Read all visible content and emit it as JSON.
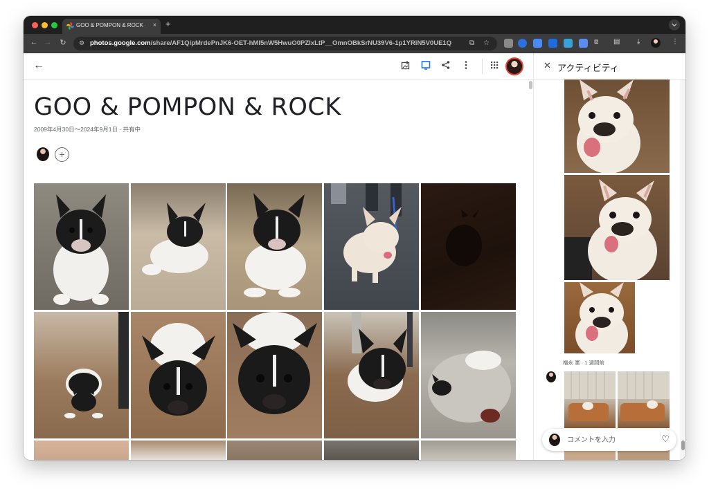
{
  "browser": {
    "tab_title": "GOO & POMPON & ROCK - G",
    "tab_close": "×",
    "new_tab": "+",
    "tab_search_icon": "chevron-down-icon",
    "url_host": "photos.google.com",
    "url_path": "/share/AF1QipMrdePnJK6-OET-hMI5nW5HwuO0PZIxLtP__OmnOBkSrNU39V6-1p1YRiN5V0UE1Q"
  },
  "appbar": {
    "back_icon": "←",
    "actions": [
      "add-to-album-icon",
      "slideshow-icon",
      "share-icon",
      "more-vert-icon",
      "apps-grid-icon"
    ]
  },
  "album": {
    "title": "GOO & POMPON & ROCK",
    "meta": "2009年4月30日～2024年9月1日 · 共有中",
    "add_person": "+"
  },
  "panel": {
    "close": "✕",
    "title": "アクティビティ",
    "user_meta": "福永 憲 · 1 週間前",
    "comment_placeholder": "コメントを入力",
    "heart": "♡"
  },
  "colors": {
    "browser_bg": "#1f1f1f",
    "toolbar_bg": "#3c3c3c",
    "accent_blue": "#1a73e8",
    "avatar_ring": "#ea4335"
  }
}
